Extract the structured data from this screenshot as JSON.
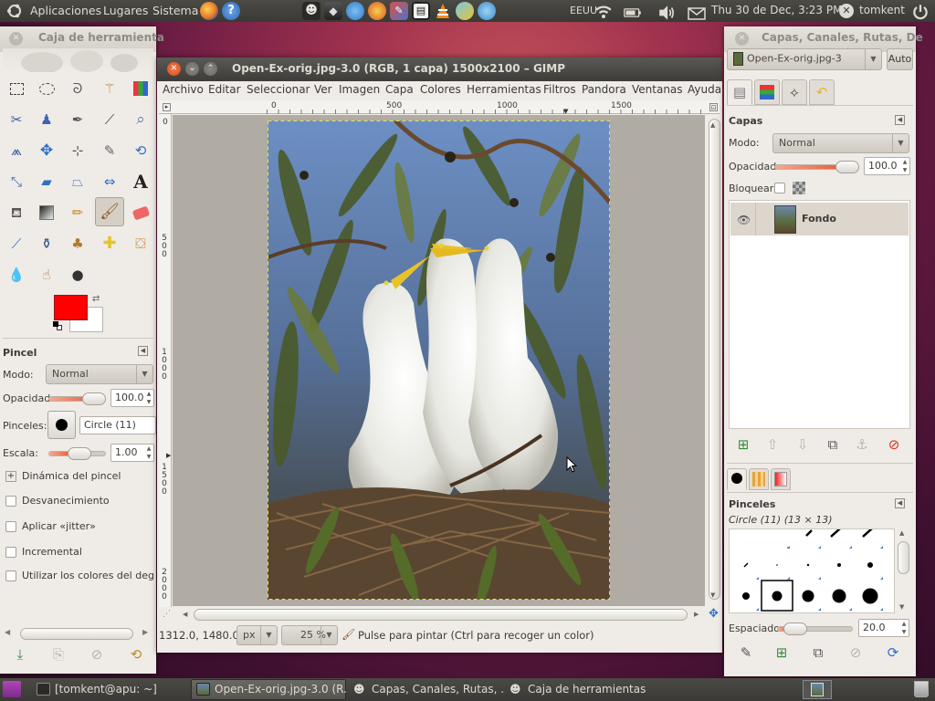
{
  "top_panel": {
    "menus": [
      "Aplicaciones",
      "Lugares",
      "Sistema"
    ],
    "keyboard_layout": "EEUU",
    "datetime": "Thu 30 de Dec,  3:23 PM",
    "user": "tomkent"
  },
  "toolbox": {
    "title": "Caja de herramienta",
    "fg_color": "#ff0000",
    "bg_color": "#ffffff",
    "options_title": "Pincel",
    "mode_label": "Modo:",
    "mode_value": "Normal",
    "opacity_label": "Opacidad:",
    "opacity_value": "100.0",
    "opacity_fraction": 1.0,
    "brushes_label": "Pinceles:",
    "brush_name": "Circle (11)",
    "scale_label": "Escala:",
    "scale_value": "1.00",
    "dynamics_label": "Dinámica del pincel",
    "options": [
      "Desvanecimiento",
      "Aplicar «jitter»",
      "Incremental",
      "Utilizar los colores del degradado"
    ]
  },
  "image_window": {
    "title": "Open-Ex-orig.jpg-3.0 (RGB, 1 capa) 1500x2100 – GIMP",
    "menus": [
      "Archivo",
      "Editar",
      "Seleccionar",
      "Ver",
      "Imagen",
      "Capa",
      "Colores",
      "Herramientas",
      "Filtros",
      "Pandora",
      "Ventanas",
      "Ayuda"
    ],
    "hruler": [
      "0",
      "500",
      "1000",
      "1500"
    ],
    "vruler": [
      "0",
      "500",
      "1000",
      "1500",
      "2000"
    ],
    "coords": "1312.0, 1480.0",
    "unit": "px",
    "zoom": "25 %",
    "status": "Pulse para pintar (Ctrl para recoger un color)"
  },
  "layers_dock": {
    "title": "Capas, Canales, Rutas, De",
    "image_combo": "Open-Ex-orig.jpg-3",
    "auto_button": "Auto",
    "section_title": "Capas",
    "mode_label": "Modo:",
    "mode_value": "Normal",
    "opacity_label": "Opacidad:",
    "opacity_value": "100.0",
    "lock_label": "Bloquear:",
    "layers": [
      {
        "name": "Fondo"
      }
    ],
    "brushes_title": "Pinceles",
    "brush_info": "Circle (11) (13 × 13)",
    "spacing_label": "Espaciado:",
    "spacing_value": "20.0",
    "spacing_fraction": 0.2
  },
  "taskbar": {
    "tasks": [
      "[tomkent@apu: ~]",
      "Open-Ex-orig.jpg-3.0 (R...",
      "Capas, Canales, Rutas, ...",
      "Caja de herramientas"
    ]
  },
  "icons": {
    "panel": [
      "ubuntu-logo-icon",
      "firefox-icon",
      "help-icon",
      "network-icon",
      "battery-icon",
      "volume-icon",
      "mail-icon",
      "power-icon"
    ],
    "tools": [
      "rect-select",
      "ellipse-select",
      "free-select",
      "fuzzy-select",
      "color-select",
      "scissors",
      "foreground-select",
      "paths",
      "color-picker",
      "zoom",
      "measure",
      "move",
      "align",
      "crop",
      "rotate",
      "scale",
      "shear",
      "perspective",
      "flip",
      "text",
      "bucket-fill",
      "blend",
      "pencil",
      "paintbrush",
      "eraser",
      "airbrush",
      "ink",
      "clone",
      "heal",
      "perspective-clone",
      "blur",
      "smudge",
      "dodge-burn"
    ]
  },
  "colors": {
    "accent": "#e8472a",
    "panel": "#3c3b37",
    "window_bg": "#efebe7"
  }
}
